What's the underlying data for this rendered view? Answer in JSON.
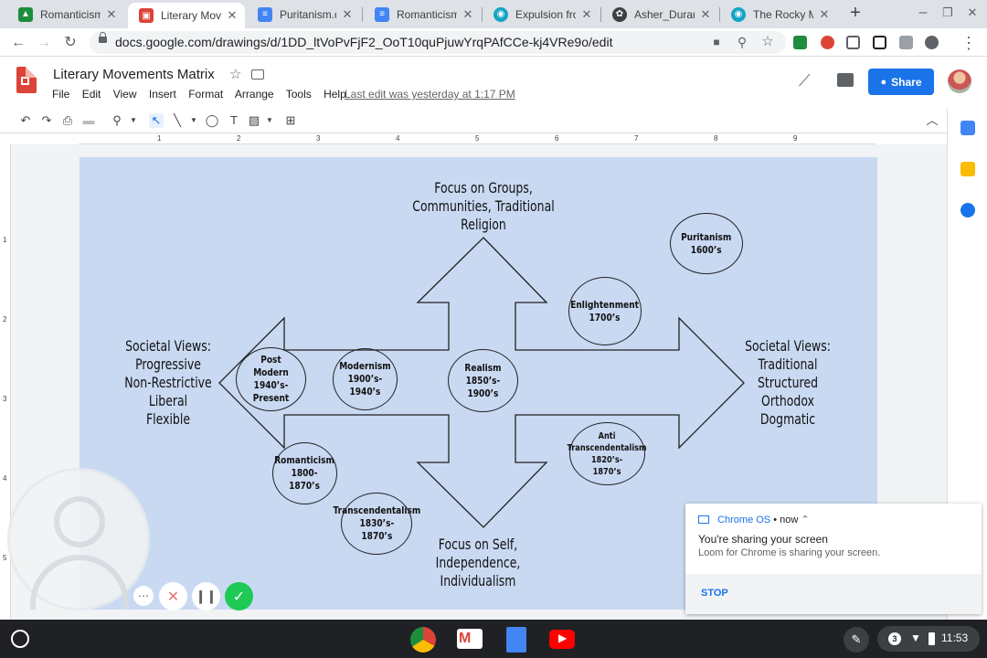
{
  "browser": {
    "tabs": [
      {
        "title": "Romanticism",
        "active": false,
        "color": "#1e8e3e"
      },
      {
        "title": "Literary Movements Matrix",
        "active": true,
        "color": "#db4437"
      },
      {
        "title": "Puritanism.docx",
        "active": false,
        "color": "#4285f4"
      },
      {
        "title": "Romanticism 2",
        "active": false,
        "color": "#4285f4"
      },
      {
        "title": "Expulsion from the Garden of Eden",
        "active": false,
        "color": "#12a4c4"
      },
      {
        "title": "Asher_Durand_Kindred_Spirits",
        "active": false,
        "color": "#3c4043"
      },
      {
        "title": "The Rocky Mountains",
        "active": false,
        "color": "#12a4c4"
      }
    ],
    "url": "docs.google.com/drawings/d/1DD_ltVoPvFjF2_OoT10quPjuwYrqPAfCCe-kj4VRe9o/edit"
  },
  "doc": {
    "title": "Literary Movements Matrix",
    "menu": [
      "File",
      "Edit",
      "View",
      "Insert",
      "Format",
      "Arrange",
      "Tools",
      "Help"
    ],
    "last_edit": "Last edit was yesterday at 1:17 PM",
    "share_label": "Share"
  },
  "ruler": {
    "marks": [
      "1",
      "2",
      "3",
      "4",
      "5",
      "6",
      "7",
      "8",
      "9"
    ],
    "vmarks": [
      "1",
      "2",
      "3",
      "4",
      "5"
    ]
  },
  "diagram": {
    "top_label": "Focus on Groups,\nCommunities, Traditional\nReligion",
    "bottom_label": "Focus on Self,\nIndependence,\nIndividualism",
    "left_label": "Societal Views:\nProgressive\nNon-Restrictive\nLiberal\nFlexible",
    "right_label": "Societal Views:\nTraditional\nStructured\nOrthodox\nDogmatic",
    "movements": [
      {
        "id": "puritanism",
        "text": "Puritanism\n1600’s"
      },
      {
        "id": "enlightenment",
        "text": "Enlightenment\n1700’s"
      },
      {
        "id": "realism",
        "text": "Realism\n1850’s-\n1900’s"
      },
      {
        "id": "modernism",
        "text": "Modernism\n1900’s-\n1940’s"
      },
      {
        "id": "post-modern",
        "text": "Post Modern\n1940’s-\nPresent"
      },
      {
        "id": "romanticism",
        "text": "Romanticism\n1800- 1870’s"
      },
      {
        "id": "transcendentalism",
        "text": "Transcendentalism\n1830’s-\n1870’s"
      },
      {
        "id": "anti-transcendentalism",
        "text": "Anti\nTranscendentalism\n1820’s-\n1870’s"
      }
    ]
  },
  "notification": {
    "source": "Chrome OS",
    "time": "• now",
    "title": "You're sharing your screen",
    "body": "Loom for Chrome is sharing your screen.",
    "action": "STOP"
  },
  "shelf": {
    "clock": "11:53",
    "badge": "3"
  }
}
